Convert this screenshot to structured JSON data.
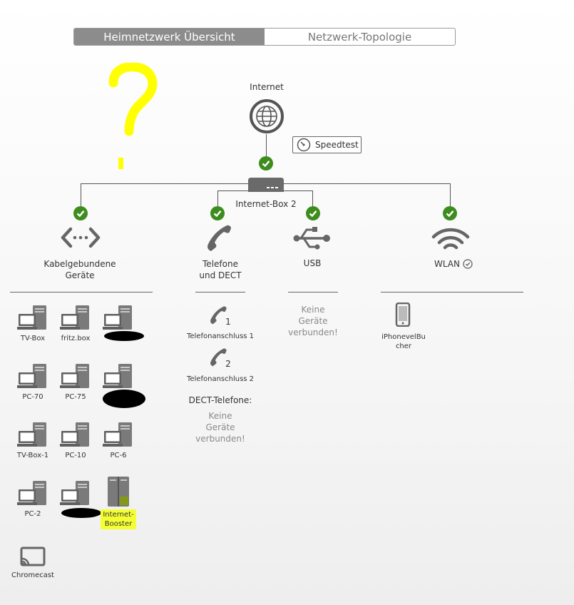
{
  "tabs": [
    {
      "label": "Heimnetzwerk Übersicht",
      "active": true
    },
    {
      "label": "Netzwerk-Topologie",
      "active": false
    }
  ],
  "annotation": {
    "symbol": "?",
    "color": "#ffff00"
  },
  "internet": {
    "label": "Internet",
    "icon": "globe-icon"
  },
  "speedtest": {
    "label": "Speedtest",
    "icon": "gauge-icon"
  },
  "router": {
    "label": "Internet-Box 2",
    "icon": "router-icon"
  },
  "status_color": "#3d8c1e",
  "categories": {
    "wired": {
      "label_line1": "Kabelgebundene",
      "label_line2": "Geräte",
      "icon": "ethernet-icon"
    },
    "phone": {
      "label_line1": "Telefone",
      "label_line2": "und DECT",
      "icon": "phone-icon"
    },
    "usb": {
      "label": "USB",
      "icon": "usb-icon"
    },
    "wlan": {
      "label": "WLAN",
      "icon": "wifi-icon"
    }
  },
  "wired_devices": [
    {
      "label": "TV-Box"
    },
    {
      "label": "fritz.box"
    },
    {
      "label": ""
    },
    {
      "label": "PC-70"
    },
    {
      "label": "PC-75"
    },
    {
      "label": ""
    },
    {
      "label": "TV-Box-1"
    },
    {
      "label": "PC-10"
    },
    {
      "label": "PC-6"
    },
    {
      "label": "PC-2"
    },
    {
      "label": ""
    },
    {
      "label": "Internet-",
      "label2": "Booster"
    },
    {
      "label": "Chromecast"
    }
  ],
  "phones": {
    "lines": [
      {
        "number": "1",
        "label": "Telefonanschluss 1"
      },
      {
        "number": "2",
        "label": "Telefonanschluss 2"
      }
    ],
    "dect_title": "DECT-Telefone:",
    "dect_empty": [
      "Keine",
      "Geräte",
      "verbunden!"
    ]
  },
  "usb_empty": [
    "Keine",
    "Geräte",
    "verbunden!"
  ],
  "wlan_devices": [
    {
      "label_line1": "iPhonevelBu",
      "label_line2": "cher"
    }
  ]
}
